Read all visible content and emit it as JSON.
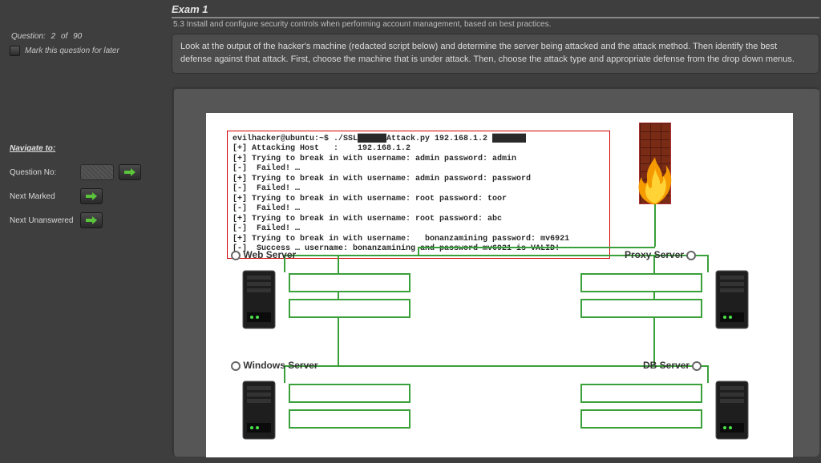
{
  "sidebar": {
    "question_label": "Question:",
    "question_num": "2",
    "of_label": "of",
    "question_total": "90",
    "mark_later": "Mark this question for later",
    "nav_header": "Navigate to:",
    "rows": [
      {
        "label": "Question No:"
      },
      {
        "label": "Next Marked"
      },
      {
        "label": "Next Unanswered"
      }
    ]
  },
  "main": {
    "exam_title": "Exam 1",
    "objective": "5.3 Install and configure security controls when performing account management, based on best practices.",
    "question": "Look at the output of the hacker's machine (redacted script below) and determine the server being attacked and the attack method. Then identify the best defense against that attack. First, choose the machine that is under attack. Then, choose the attack type and appropriate defense from the drop down menus."
  },
  "terminal": {
    "lines": [
      "evilhacker@ubuntu:~$ ./SSL██████Attack.py 192.168.1.2 ███████",
      "[+] Attacking Host   :    192.168.1.2",
      "[+] Trying to break in with username: admin password: admin",
      "[-]  Failed! …",
      "[+] Trying to break in with username: admin password: password",
      "[-]  Failed! …",
      "[+] Trying to break in with username: root password: toor",
      "[-]  Failed! …",
      "[+] Trying to break in with username: root password: abc",
      "[-]  Failed! …",
      "[+] Trying to break in with username:   bonanzamining password: mv6921",
      "[-]  Success … username: bonanzamining and password mv6921 is VALID!"
    ]
  },
  "servers": {
    "web": "Web Server",
    "proxy": "Proxy Server",
    "windows": "Windows Server",
    "db": "DB Server"
  }
}
